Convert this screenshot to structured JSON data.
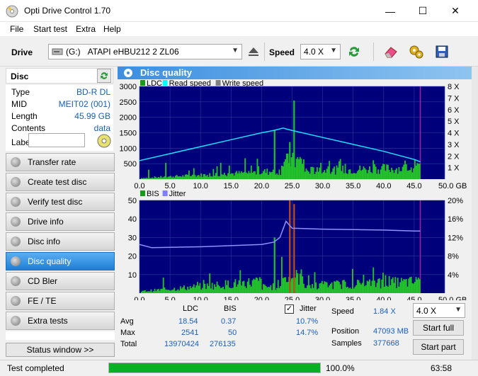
{
  "window": {
    "title": "Opti Drive Control 1.70",
    "minimize": "—",
    "maximize": "☐",
    "close": "✕"
  },
  "menu": [
    "File",
    "Start test",
    "Extra",
    "Help"
  ],
  "toolbar": {
    "drive_label": "Drive",
    "drive_letter": "(G:)",
    "drive_name": "ATAPI  eHBU212   2 ZL06",
    "speed_label": "Speed",
    "speed_value": "4.0 X"
  },
  "sidebar": {
    "disc_title": "Disc",
    "info": [
      {
        "key": "Type",
        "value": "BD-R DL"
      },
      {
        "key": "MID",
        "value": "MEIT02 (001)"
      },
      {
        "key": "Length",
        "value": "45.99 GB"
      },
      {
        "key": "Contents",
        "value": "data"
      }
    ],
    "label_key": "Label",
    "label_value": "",
    "nav": [
      {
        "label": "Transfer rate"
      },
      {
        "label": "Create test disc"
      },
      {
        "label": "Verify test disc"
      },
      {
        "label": "Drive info"
      },
      {
        "label": "Disc info"
      },
      {
        "label": "Disc quality",
        "active": true
      },
      {
        "label": "CD Bler"
      },
      {
        "label": "FE / TE"
      },
      {
        "label": "Extra tests"
      }
    ],
    "status_window": "Status window >>"
  },
  "panel": {
    "title": "Disc quality"
  },
  "chart_data": [
    {
      "type": "area",
      "legend": [
        "LDC",
        "Read speed",
        "Write speed"
      ],
      "legend_colors": [
        "#1a9a1a",
        "#00ffff",
        "#808080"
      ],
      "x": [
        0,
        5,
        10,
        15,
        20,
        22,
        23.5,
        25,
        30,
        35,
        40,
        45,
        46
      ],
      "series": [
        {
          "name": "Read speed",
          "unit": "X",
          "values": [
            1.6,
            2.2,
            2.8,
            3.4,
            4.0,
            4.2,
            4.4,
            4.2,
            3.6,
            3.0,
            2.4,
            1.7,
            1.5
          ]
        }
      ],
      "ldc_peaks": [
        {
          "x": 22,
          "y": 1600
        },
        {
          "x": 25.2,
          "y": 2541
        },
        {
          "x": 24.5,
          "y": 1200
        }
      ],
      "xlim": [
        0,
        50
      ],
      "ylim": [
        0,
        3000
      ],
      "y2lim": [
        0,
        8
      ],
      "xticks": [
        "0.0",
        "5.0",
        "10.0",
        "15.0",
        "20.0",
        "25.0",
        "30.0",
        "35.0",
        "40.0",
        "45.0",
        "50.0 GB"
      ],
      "yticks": [
        "3000",
        "2500",
        "2000",
        "1500",
        "1000",
        "500"
      ],
      "y2ticks": [
        "8 X",
        "7 X",
        "6 X",
        "5 X",
        "4 X",
        "3 X",
        "2 X",
        "1 X"
      ]
    },
    {
      "type": "area",
      "legend": [
        "BIS",
        "Jitter"
      ],
      "legend_colors": [
        "#1a9a1a",
        "#8080ff"
      ],
      "x": [
        0,
        2,
        10,
        20,
        22,
        23,
        24,
        25,
        30,
        40,
        45,
        46
      ],
      "series": [
        {
          "name": "Jitter",
          "unit": "%",
          "values": [
            10.5,
            9.8,
            10.0,
            10.5,
            11.0,
            12.0,
            15.5,
            14.0,
            13.8,
            13.6,
            13.4,
            13.4
          ]
        }
      ],
      "bis_peaks": [
        {
          "x": 22,
          "y": 30
        },
        {
          "x": 24.5,
          "y": 50
        },
        {
          "x": 25.2,
          "y": 48
        }
      ],
      "xlim": [
        0,
        50
      ],
      "ylim": [
        0,
        50
      ],
      "y2lim": [
        0,
        20
      ],
      "xticks": [
        "0.0",
        "5.0",
        "10.0",
        "15.0",
        "20.0",
        "25.0",
        "30.0",
        "35.0",
        "40.0",
        "45.0",
        "50.0 GB"
      ],
      "yticks": [
        "50",
        "40",
        "30",
        "20",
        "10"
      ],
      "y2ticks": [
        "20%",
        "16%",
        "12%",
        "8%",
        "4%"
      ]
    }
  ],
  "stats": {
    "col_ldc": "LDC",
    "col_bis": "BIS",
    "jitter_label": "Jitter",
    "rows": [
      {
        "name": "Avg",
        "ldc": "18.54",
        "bis": "0.37",
        "jitter": "10.7%"
      },
      {
        "name": "Max",
        "ldc": "2541",
        "bis": "50",
        "jitter": "14.7%"
      },
      {
        "name": "Total",
        "ldc": "13970424",
        "bis": "276135",
        "jitter": ""
      }
    ],
    "speed_label": "Speed",
    "speed_value": "1.84 X",
    "position_label": "Position",
    "position_value": "47093 MB",
    "samples_label": "Samples",
    "samples_value": "377668",
    "speed_select": "4.0 X",
    "start_full": "Start full",
    "start_part": "Start part"
  },
  "status": {
    "text": "Test completed",
    "percent": "100.0%",
    "progress": 1.0,
    "time": "63:58"
  }
}
